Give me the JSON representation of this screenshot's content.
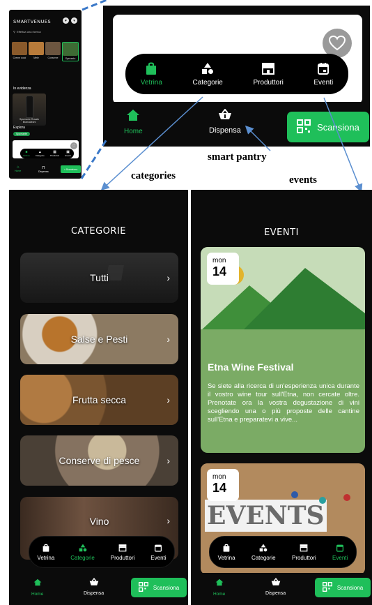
{
  "colors": {
    "accent": "#1fbf5a",
    "background": "#0b0b0b",
    "card_green": "#7bab65"
  },
  "small_screen": {
    "app_title": "SMARTVENUES",
    "search_placeholder": "Effettua una ricerca",
    "categories": [
      {
        "label": "Creme dolci",
        "color": "#8a5a2b"
      },
      {
        "label": "Mele",
        "color": "#b87b3a"
      },
      {
        "label": "Conserve",
        "color": "#6d5640"
      },
      {
        "label": "Spezzato",
        "color": "#3e6b34"
      }
    ],
    "featured_title": "In evidenza",
    "featured_card_label": "Spumante Rosato Brancaleoni",
    "explore_title": "Esplora",
    "explore_chip": "Spumante",
    "nav_tabs": [
      "Vetrina",
      "Categorie",
      "Produttori",
      "Eventi"
    ],
    "bottom": {
      "home": "Home",
      "pantry": "Dispensa",
      "scan": "Scansiona"
    }
  },
  "zoom": {
    "nav_tabs": [
      {
        "label": "Vetrina",
        "icon": "bag-icon",
        "active": true
      },
      {
        "label": "Categorie",
        "icon": "shapes-icon",
        "active": false
      },
      {
        "label": "Produttori",
        "icon": "store-icon",
        "active": false
      },
      {
        "label": "Eventi",
        "icon": "calendar-icon",
        "active": false
      }
    ],
    "bottom": {
      "home": "Home",
      "pantry": "Dispensa",
      "scan": "Scansiona"
    }
  },
  "annotations": {
    "smart_pantry": "smart pantry",
    "categories": "categories",
    "events": "events"
  },
  "categorie_screen": {
    "title": "CATEGORIE",
    "items": [
      {
        "label": "Tutti",
        "bg": "#262626"
      },
      {
        "label": "Salse e Pesti",
        "bg": "#a08a72"
      },
      {
        "label": "Frutta secca",
        "bg": "#8c6840"
      },
      {
        "label": "Conserve di pesce",
        "bg": "#736a5e"
      },
      {
        "label": "Vino",
        "bg": "#4e3a2c"
      }
    ],
    "nav_tabs": [
      {
        "label": "Vetrina",
        "active": false
      },
      {
        "label": "Categorie",
        "active": true
      },
      {
        "label": "Produttori",
        "active": false
      },
      {
        "label": "Eventi",
        "active": false
      }
    ],
    "bottom": {
      "home": "Home",
      "pantry": "Dispensa",
      "scan": "Scansiona"
    }
  },
  "eventi_screen": {
    "title": "EVENTI",
    "events": [
      {
        "day_name": "mon",
        "day_number": "14",
        "title": "Etna Wine Festival",
        "description": "Se siete alla ricerca di un'esperienza unica durante il vostro wine tour sull'Etna, non cercate oltre. Prenotate ora la vostra degustazione di vini scegliendo una o più proposte delle cantine sull'Etna e preparatevi a vive..."
      },
      {
        "day_name": "mon",
        "day_number": "14",
        "image_text": "EVENTS"
      }
    ],
    "nav_tabs": [
      {
        "label": "Vetrina",
        "active": false
      },
      {
        "label": "Categorie",
        "active": false
      },
      {
        "label": "Produttori",
        "active": false
      },
      {
        "label": "Eventi",
        "active": true
      }
    ],
    "bottom": {
      "home": "Home",
      "pantry": "Dispensa",
      "scan": "Scansiona"
    }
  }
}
